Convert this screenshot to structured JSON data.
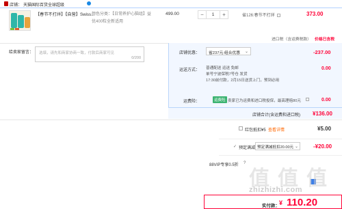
{
  "store": {
    "label": "店铺：",
    "name": "天猫国际百货全球超级",
    "logo_color": "#c40000",
    "badge_color": "#1a89e6"
  },
  "product": {
    "title_tag": "【春节不打烊】",
    "title": "【自营】Swiss...",
    "options_line1": "颜色分类：【日常养护心脑组】益",
    "options_line2": "优400粒全新适用",
    "unit_price": "499.00",
    "quantity": "1",
    "qty_minus": "−",
    "qty_plus": "+",
    "promo_note": "省126:春节不打烊",
    "subtotal": "373.00",
    "price_notice": "价格已含税",
    "image_colors": [
      "#2fb6a8",
      "#f7f1e3"
    ]
  },
  "tax_row": {
    "label": "进口税（含运费税款）",
    "value": "价格已含税"
  },
  "message": {
    "label": "给卖家留言：",
    "placeholder": "选填，请先和商家协商一致，付款后商家可见",
    "counter": "0/200"
  },
  "shop_discount": {
    "label": "店铺优惠：",
    "selected": "省237元:组合优惠",
    "amount": "-237.00"
  },
  "shipping": {
    "label": "运送方式：",
    "method": "普通配送 运送 免邮",
    "line2": "单号宁波保税7号仓 发货",
    "line3": "17:30前付款，2月15日送货上门，预到必用",
    "fee": "0.00"
  },
  "shipping_insurance": {
    "label": "运费险：",
    "tag": "运费险",
    "text": "卖家已为运费和进口税投保，最高理赔80元",
    "fee": "0.00"
  },
  "store_total": {
    "label": "店铺合计(含运费和进口税)",
    "amount": "¥136.00"
  },
  "red_packet": {
    "label": "红包抵扣¥5",
    "link": "查看详情",
    "amount": "¥5.00"
  },
  "presale": {
    "label": "预定满减",
    "selected": "预定满减抵扣20.00元",
    "amount": "-¥20.00"
  },
  "vip": {
    "label": "88VIP专享0.5折"
  },
  "footer": {
    "label": "实付款：",
    "currency": "¥",
    "amount": "110.20"
  },
  "watermark": {
    "chars": [
      "值",
      "值",
      "值"
    ],
    "url": "zhizhizhi.com"
  }
}
